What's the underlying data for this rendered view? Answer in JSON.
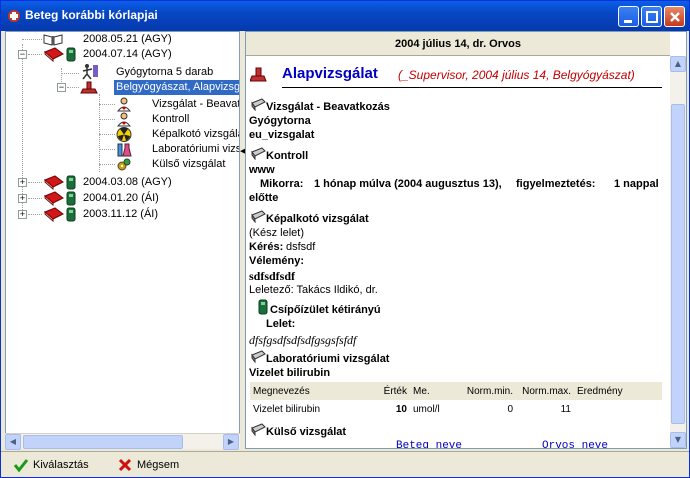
{
  "window": {
    "title": "Beteg korábbi kórlapjai",
    "controls": {
      "minimize": "minimize-icon",
      "maximize": "maximize-icon",
      "close": "close-icon"
    }
  },
  "tree": {
    "items": [
      {
        "label": "2008.05.21 (AGY)",
        "icon": "open-book-icon"
      },
      {
        "label": "2004.07.14 (AGY)",
        "icon": "red-book-icon"
      },
      {
        "label": "Gyógytorna 5 darab",
        "icon": "exercise-icon"
      },
      {
        "label": "Belgyógyászat, Alapvizsg",
        "icon": "stamp-icon"
      },
      {
        "label": "Vizsgálat - Beavatk",
        "icon": "doctor-icon"
      },
      {
        "label": "Kontroll",
        "icon": "doctor-icon"
      },
      {
        "label": "Képalkotó vizsgálat",
        "icon": "radiation-icon"
      },
      {
        "label": "Laboratóriumi vizs",
        "icon": "flask-icon"
      },
      {
        "label": "Külső vizsgálat",
        "icon": "gears-icon"
      },
      {
        "label": "2004.03.08 (AGY)",
        "icon": "red-book-icon"
      },
      {
        "label": "2004.01.20 (ÁI)",
        "icon": "red-book-icon"
      },
      {
        "label": "2003.11.12 (ÁI)",
        "icon": "red-book-icon"
      }
    ]
  },
  "document": {
    "header": "2004 július 14,  dr. Orvos",
    "title": "Alapvizsgálat",
    "subtitle": "(_Supervisor, 2004 július 14, Belgyógyászat)",
    "sections": {
      "vizsgalat": {
        "title": "Vizsgálat - Beavatkozás",
        "line1": "Gyógytorna",
        "line2": "eu_vizsgalat"
      },
      "kontroll": {
        "title": "Kontroll",
        "line1": "www",
        "mikorra_label": "Mikorra:",
        "mikorra_value": "1 hónap múlva (2004 augusztus 13),",
        "figy_label": "figyelmeztetés:",
        "figy_value": "1 nappal",
        "elotte": "előtte"
      },
      "kepalkoto": {
        "title": "Képalkotó vizsgálat",
        "status": "(Kész lelet)",
        "keres_label": "Kérés:",
        "keres_value": "dsfsdf",
        "velemeny_label": "Vélemény:",
        "velemeny_value": "sdfsdfsdf",
        "leletezo": "Leletező: Takács Ildikó, dr."
      },
      "csipo": {
        "title": "Csípőízület kétirányú",
        "lelet_label": "Lelet:",
        "lelet_value": "dfsfgsdfsdfsdfgsgsfsfdf"
      },
      "labor": {
        "title": "Laboratóriumi vizsgálat",
        "subtitle": "Vizelet bilirubin",
        "columns": [
          "Megnevezés",
          "Érték",
          "Me.",
          "Norm.min.",
          "Norm.max.",
          "Eredmény"
        ],
        "rows": [
          [
            "Vizelet bilirubin",
            "10",
            "umol/l",
            "0",
            "11",
            ""
          ]
        ]
      },
      "kulso": {
        "title": "Külső vizsgálat",
        "beteg_neve": "Beteg neve",
        "orvos_neve": "Orvos neve"
      }
    }
  },
  "buttons": {
    "select": {
      "label": "Kiválasztás",
      "icon": "checkmark-icon"
    },
    "cancel": {
      "label": "Mégsem",
      "icon": "x-icon"
    }
  },
  "colors": {
    "titlebar": "#0a5fe8",
    "selection": "#316ac5",
    "title_blue": "#0000c0",
    "subtitle_red": "#c00000"
  }
}
